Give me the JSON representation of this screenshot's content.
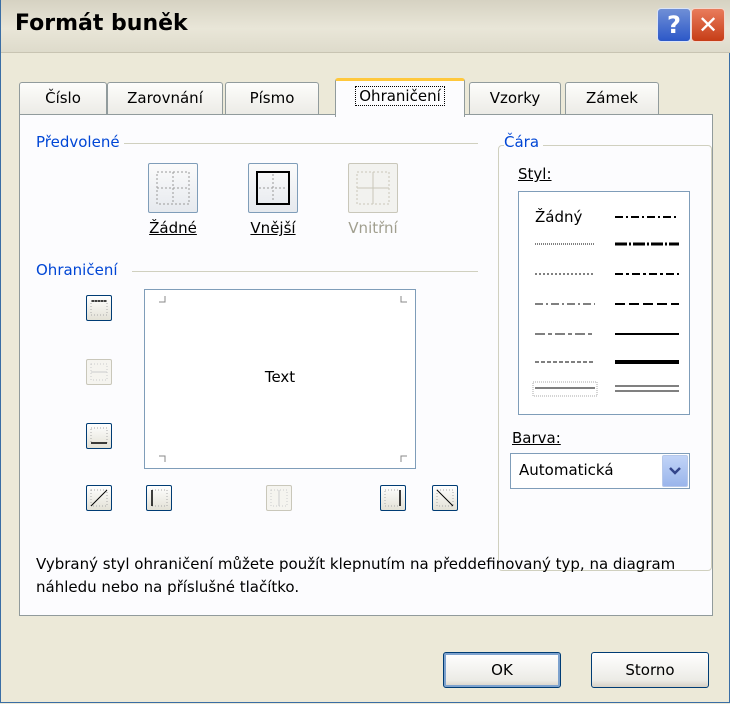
{
  "window": {
    "title": "Formát buněk"
  },
  "tabs": [
    {
      "label": "Číslo"
    },
    {
      "label": "Zarovnání"
    },
    {
      "label": "Písmo"
    },
    {
      "label": "Ohraničení"
    },
    {
      "label": "Vzorky"
    },
    {
      "label": "Zámek"
    }
  ],
  "active_tab": "Ohraničení",
  "presets": {
    "label": "Předvolené",
    "none_label": "Žádné",
    "outline_label": "Vnější",
    "inside_label": "Vnitřní"
  },
  "border": {
    "label": "Ohraničení",
    "preview_text": "Text"
  },
  "line": {
    "label": "Čára",
    "style_label": "Styl:",
    "none_style": "Žádný",
    "color_label": "Barva:",
    "color_value": "Automatická"
  },
  "description": "Vybraný styl ohraničení můžete použít klepnutím na předdefinovaný typ, na diagram náhledu nebo na příslušné tlačítko.",
  "buttons": {
    "ok": "OK",
    "cancel": "Storno"
  },
  "colors": {
    "accent": "#0046d5",
    "tab_highlight": "#ffc83c",
    "dialog_bg": "#ece9d8"
  }
}
